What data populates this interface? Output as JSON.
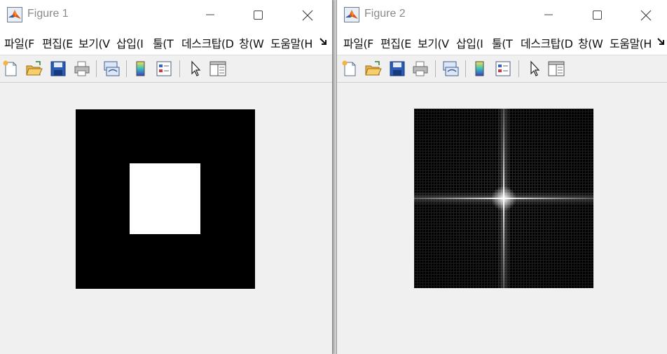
{
  "windows": [
    {
      "title": "Figure 1",
      "menu": [
        "파일(F",
        "편집(E",
        "보기(V",
        "삽입(I",
        "툴(T",
        "데스크탑(D",
        "창(W",
        "도움말(H"
      ],
      "image": {
        "type": "square",
        "content": "white square centered on black background"
      }
    },
    {
      "title": "Figure 2",
      "menu": [
        "파일(F",
        "편집(E",
        "보기(V",
        "삽입(I",
        "툴(T",
        "데스크탑(D",
        "창(W",
        "도움말(H"
      ],
      "image": {
        "type": "spectrum",
        "content": "magnitude spectrum with bright central cross on black"
      }
    }
  ],
  "toolbar_icons": [
    "new-figure-icon",
    "open-file-icon",
    "save-icon",
    "print-icon",
    "link-plot-icon",
    "colorbar-icon",
    "legend-icon",
    "edit-plot-pointer-icon",
    "property-editor-icon"
  ],
  "colors": {
    "titlebar": "#ffffff",
    "title_text": "#8a8a8a",
    "figure_bg": "#f0f0f0",
    "axes_bg": "#000000",
    "square": "#ffffff"
  }
}
